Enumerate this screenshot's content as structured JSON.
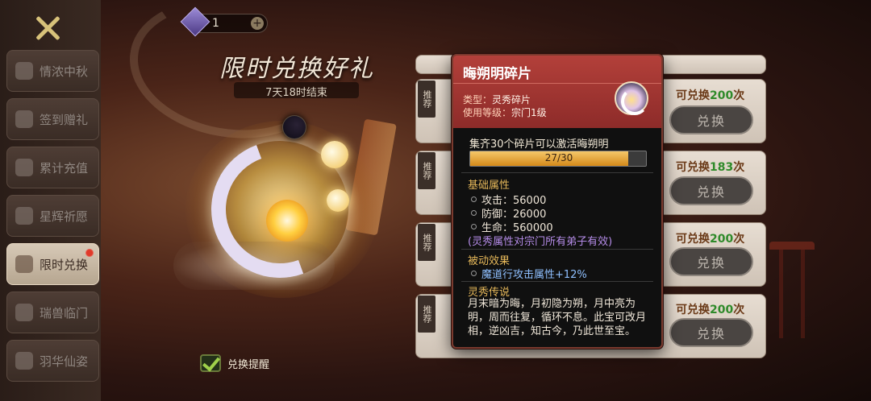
{
  "currency": {
    "amount": "1",
    "plus": "+"
  },
  "event": {
    "title": "限时兑换好礼",
    "timer": "7天18时结束"
  },
  "sidebar": {
    "items": [
      {
        "label": "情浓中秋"
      },
      {
        "label": "签到赠礼"
      },
      {
        "label": "累计充值"
      },
      {
        "label": "星辉祈愿"
      },
      {
        "label": "限时兑换",
        "active": true
      },
      {
        "label": "瑞兽临门"
      },
      {
        "label": "羽华仙姿"
      }
    ]
  },
  "remind": {
    "label": "兑换提醒"
  },
  "exchange_list": {
    "rows": [
      {
        "tag": "推荐",
        "count_prefix": "可兑换",
        "count": "200",
        "count_suffix": "次",
        "button": "兑换"
      },
      {
        "tag": "推荐",
        "count_prefix": "可兑换",
        "count": "183",
        "count_suffix": "次",
        "button": "兑换"
      },
      {
        "tag": "推荐",
        "count_prefix": "可兑换",
        "count": "200",
        "count_suffix": "次",
        "button": "兑换"
      },
      {
        "tag": "推荐",
        "count_prefix": "可兑换",
        "count": "200",
        "count_suffix": "次",
        "button": "兑换"
      }
    ]
  },
  "tooltip": {
    "name": "晦朔明碎片",
    "type_label": "类型：",
    "type_value": "灵秀碎片",
    "level_label": "使用等级：",
    "level_value": "宗门1级",
    "collect_text": "集齐30个碎片可以激活晦朔明",
    "progress_text": "27/30",
    "progress_fraction": 0.9,
    "basic_title": "基础属性",
    "stats": [
      {
        "text": "攻击：56000"
      },
      {
        "text": "防御：26000"
      },
      {
        "text": "生命：560000"
      }
    ],
    "sect_note": "(灵秀属性对宗门所有弟子有效)",
    "passive_title": "被动效果",
    "passive_text": "魔道行攻击属性+12%",
    "lore_title": "灵秀传说",
    "lore_text": "月末暗为晦，月初隐为朔，月中亮为明，周而往复，循环不息。此宝可改月相，逆凶吉，知古今，乃此世至宝。"
  },
  "colors": {
    "tooltip_header": "#a6362f",
    "progress_fill": "#e3a33a",
    "passive": "#8fc0ff",
    "note": "#b58ce8"
  }
}
